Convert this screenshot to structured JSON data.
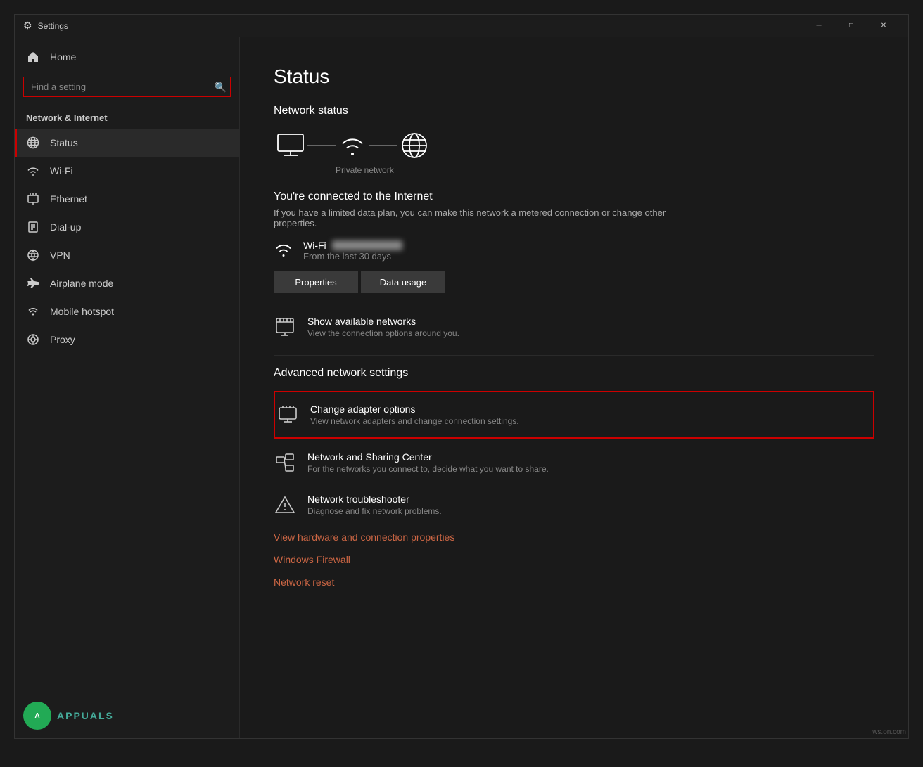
{
  "window": {
    "title": "Settings",
    "controls": {
      "minimize": "─",
      "maximize": "□",
      "close": "✕"
    }
  },
  "sidebar": {
    "back_label": "Home",
    "search_placeholder": "Find a setting",
    "section_title": "Network & Internet",
    "nav_items": [
      {
        "id": "status",
        "label": "Status",
        "icon": "globe",
        "active": true
      },
      {
        "id": "wifi",
        "label": "Wi-Fi",
        "icon": "wifi"
      },
      {
        "id": "ethernet",
        "label": "Ethernet",
        "icon": "ethernet"
      },
      {
        "id": "dialup",
        "label": "Dial-up",
        "icon": "dialup"
      },
      {
        "id": "vpn",
        "label": "VPN",
        "icon": "vpn"
      },
      {
        "id": "airplane",
        "label": "Airplane mode",
        "icon": "airplane"
      },
      {
        "id": "hotspot",
        "label": "Mobile hotspot",
        "icon": "hotspot"
      },
      {
        "id": "proxy",
        "label": "Proxy",
        "icon": "proxy"
      }
    ]
  },
  "main": {
    "page_title": "Status",
    "network_status_title": "Network status",
    "network_label": "Private network",
    "connected_title": "You're connected to the Internet",
    "connected_sub": "If you have a limited data plan, you can make this network a metered connection or change other properties.",
    "wifi_name_blurred": true,
    "wifi_prefix": "Wi-Fi",
    "wifi_days": "From the last 30 days",
    "buttons": {
      "properties": "Properties",
      "data_usage": "Data usage"
    },
    "show_networks": {
      "title": "Show available networks",
      "sub": "View the connection options around you."
    },
    "advanced_title": "Advanced network settings",
    "advanced_items": [
      {
        "id": "change-adapter",
        "title": "Change adapter options",
        "sub": "View network adapters and change connection settings.",
        "highlighted": true
      },
      {
        "id": "sharing-center",
        "title": "Network and Sharing Center",
        "sub": "For the networks you connect to, decide what you want to share."
      },
      {
        "id": "troubleshooter",
        "title": "Network troubleshooter",
        "sub": "Diagnose and fix network problems."
      }
    ],
    "links": [
      {
        "id": "hardware-props",
        "label": "View hardware and connection properties"
      },
      {
        "id": "firewall",
        "label": "Windows Firewall"
      },
      {
        "id": "network-reset",
        "label": "Network reset"
      }
    ]
  },
  "watermark": "ws.on.com"
}
